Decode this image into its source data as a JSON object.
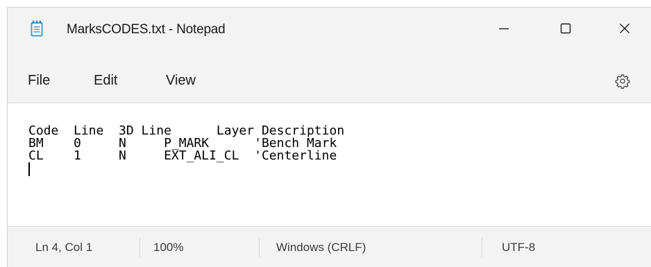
{
  "window": {
    "title": "MarksCODES.txt - Notepad",
    "app_icon": "notepad-icon",
    "controls": {
      "minimize_icon": "minimize-icon",
      "maximize_icon": "maximize-icon",
      "close_icon": "close-icon"
    }
  },
  "menu": {
    "items": [
      "File",
      "Edit",
      "View"
    ],
    "settings_icon": "gear-icon"
  },
  "editor": {
    "lines": [
      "Code  Line  3D Line      Layer Description",
      "BM    0     N     P_MARK      'Bench Mark",
      "CL    1     N     EXT_ALI_CL  'Centerline",
      ""
    ]
  },
  "status": {
    "position": "Ln 4, Col 1",
    "zoom": "100%",
    "line_ending": "Windows (CRLF)",
    "encoding": "UTF-8"
  }
}
